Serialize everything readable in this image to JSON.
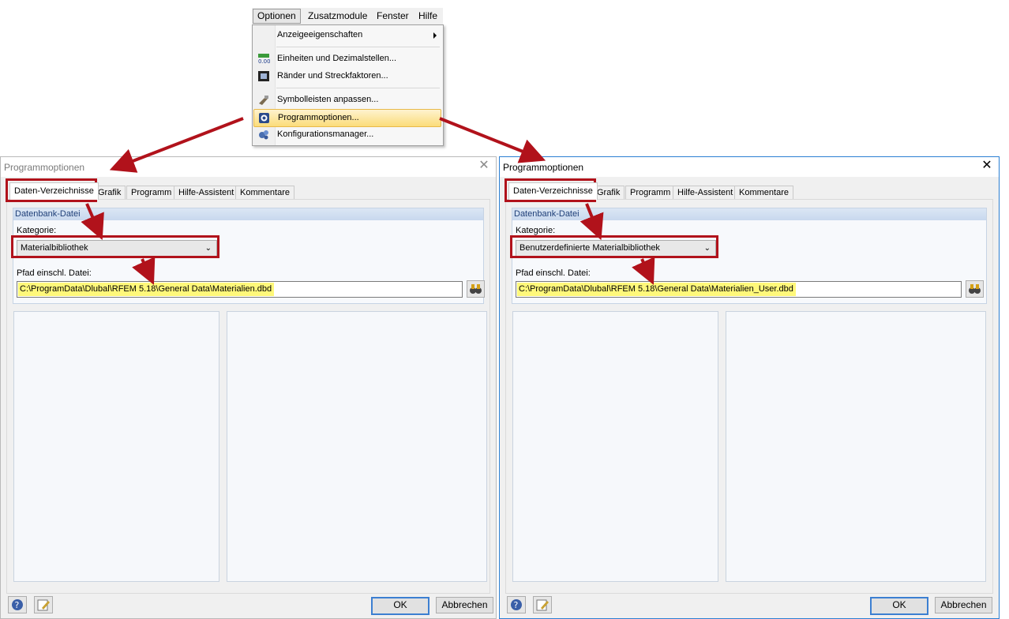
{
  "menu": {
    "bar": [
      "Optionen",
      "Zusatzmodule",
      "Fenster",
      "Hilfe"
    ],
    "items": [
      {
        "label": "Anzeigeeigenschaften",
        "icon": "none",
        "submenu": true
      },
      {
        "label": "Einheiten und Dezimalstellen...",
        "icon": "units-icon"
      },
      {
        "label": "Ränder und Streckfaktoren...",
        "icon": "margins-icon"
      },
      {
        "label": "Symbolleisten anpassen...",
        "icon": "toolbar-icon"
      },
      {
        "label": "Programmoptionen...",
        "icon": "options-icon",
        "highlighted": true
      },
      {
        "label": "Konfigurationsmanager...",
        "icon": "config-icon"
      }
    ]
  },
  "dialogs": [
    {
      "title": "Programmoptionen",
      "tabs": [
        "Daten-Verzeichnisse",
        "Grafik",
        "Programm",
        "Hilfe-Assistent",
        "Kommentare"
      ],
      "group_title": "Datenbank-Datei",
      "kategorie_label": "Kategorie:",
      "kategorie_value": "Materialbibliothek",
      "pfad_label": "Pfad einschl. Datei:",
      "pfad_value": "C:\\ProgramData\\Dlubal\\RFEM 5.18\\General Data\\Materialien.dbd",
      "ok": "OK",
      "cancel": "Abbrechen"
    },
    {
      "title": "Programmoptionen",
      "tabs": [
        "Daten-Verzeichnisse",
        "Grafik",
        "Programm",
        "Hilfe-Assistent",
        "Kommentare"
      ],
      "group_title": "Datenbank-Datei",
      "kategorie_label": "Kategorie:",
      "kategorie_value": "Benutzerdefinierte Materialbibliothek",
      "pfad_label": "Pfad einschl. Datei:",
      "pfad_value": "C:\\ProgramData\\Dlubal\\RFEM 5.18\\General Data\\Materialien_User.dbd",
      "ok": "OK",
      "cancel": "Abbrechen"
    }
  ],
  "colors": {
    "annotation_red": "#b1121b",
    "highlight_yellow": "#fff87a",
    "menu_highlight": "#fbdc7a"
  }
}
